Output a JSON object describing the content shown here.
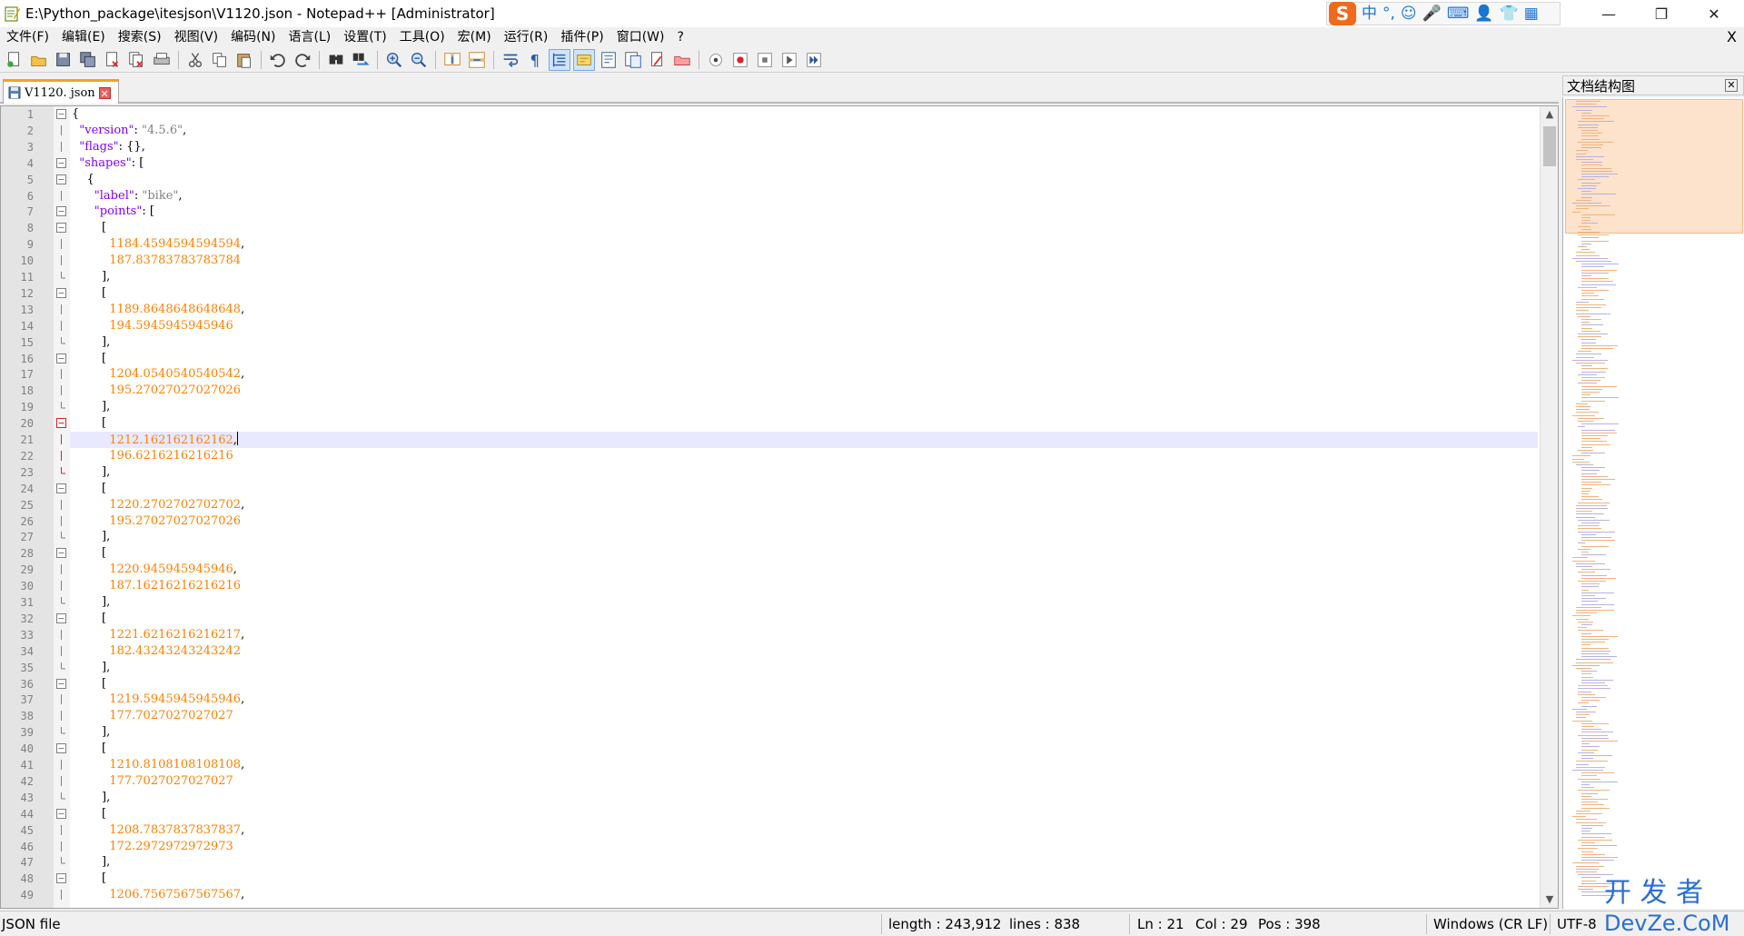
{
  "window": {
    "title": "E:\\Python_package\\itesjson\\V1120.json - Notepad++ [Administrator]",
    "minimize": "—",
    "restore": "❐",
    "close": "✕"
  },
  "menu": {
    "items": [
      "文件(F)",
      "编辑(E)",
      "搜索(S)",
      "视图(V)",
      "编码(N)",
      "语言(L)",
      "设置(T)",
      "工具(O)",
      "宏(M)",
      "运行(R)",
      "插件(P)",
      "窗口(W)",
      "?"
    ],
    "close": "X"
  },
  "ime": {
    "logo": "S",
    "glyphs": [
      "中",
      "°,",
      "☺",
      "🎤",
      "⌨",
      "👤",
      "👕",
      "▦"
    ]
  },
  "toolbar": {
    "icons": [
      "new-file-icon",
      "open-file-icon",
      "save-icon",
      "save-all-icon",
      "close-icon",
      "close-all-icon",
      "print-icon",
      "cut-icon",
      "copy-icon",
      "paste-icon",
      "undo-icon",
      "redo-icon",
      "find-icon",
      "replace-icon",
      "zoom-in-icon",
      "zoom-out-icon",
      "sync-vertical-icon",
      "sync-horizontal-icon",
      "word-wrap-icon",
      "show-all-chars-icon",
      "indent-guide-icon",
      "user-lang-icon",
      "doc-map-icon",
      "function-list-icon",
      "folder-workspace-icon",
      "monitor-icon",
      "record-macro-icon",
      "stop-record-icon",
      "play-macro-icon",
      "run-macro-multiple-icon",
      "save-macro-icon"
    ]
  },
  "tab": {
    "label": "V1120. json",
    "close": "✕"
  },
  "editor": {
    "current_line": 21,
    "lines": [
      {
        "n": 1,
        "text": "{",
        "fold": "box"
      },
      {
        "n": 2,
        "text": "  \"version\": \"4.5.6\",",
        "fold": "line"
      },
      {
        "n": 3,
        "text": "  \"flags\": {},",
        "fold": "line"
      },
      {
        "n": 4,
        "text": "  \"shapes\": [",
        "fold": "box"
      },
      {
        "n": 5,
        "text": "    {",
        "fold": "box"
      },
      {
        "n": 6,
        "text": "      \"label\": \"bike\",",
        "fold": "line"
      },
      {
        "n": 7,
        "text": "      \"points\": [",
        "fold": "box"
      },
      {
        "n": 8,
        "text": "        [",
        "fold": "box"
      },
      {
        "n": 9,
        "text": "          1184.4594594594594,",
        "fold": "line"
      },
      {
        "n": 10,
        "text": "          187.83783783783784",
        "fold": "line"
      },
      {
        "n": 11,
        "text": "        ],",
        "fold": "end"
      },
      {
        "n": 12,
        "text": "        [",
        "fold": "box"
      },
      {
        "n": 13,
        "text": "          1189.8648648648648,",
        "fold": "line"
      },
      {
        "n": 14,
        "text": "          194.5945945945946",
        "fold": "line"
      },
      {
        "n": 15,
        "text": "        ],",
        "fold": "end"
      },
      {
        "n": 16,
        "text": "        [",
        "fold": "box"
      },
      {
        "n": 17,
        "text": "          1204.0540540540542,",
        "fold": "line"
      },
      {
        "n": 18,
        "text": "          195.27027027027026",
        "fold": "line"
      },
      {
        "n": 19,
        "text": "        ],",
        "fold": "end"
      },
      {
        "n": 20,
        "text": "        [",
        "fold": "boxred"
      },
      {
        "n": 21,
        "text": "          1212.162162162162,",
        "fold": "linered"
      },
      {
        "n": 22,
        "text": "          196.6216216216216",
        "fold": "linered"
      },
      {
        "n": 23,
        "text": "        ],",
        "fold": "endred"
      },
      {
        "n": 24,
        "text": "        [",
        "fold": "box"
      },
      {
        "n": 25,
        "text": "          1220.2702702702702,",
        "fold": "line"
      },
      {
        "n": 26,
        "text": "          195.27027027027026",
        "fold": "line"
      },
      {
        "n": 27,
        "text": "        ],",
        "fold": "end"
      },
      {
        "n": 28,
        "text": "        [",
        "fold": "box"
      },
      {
        "n": 29,
        "text": "          1220.945945945946,",
        "fold": "line"
      },
      {
        "n": 30,
        "text": "          187.16216216216216",
        "fold": "line"
      },
      {
        "n": 31,
        "text": "        ],",
        "fold": "end"
      },
      {
        "n": 32,
        "text": "        [",
        "fold": "box"
      },
      {
        "n": 33,
        "text": "          1221.6216216216217,",
        "fold": "line"
      },
      {
        "n": 34,
        "text": "          182.43243243243242",
        "fold": "line"
      },
      {
        "n": 35,
        "text": "        ],",
        "fold": "end"
      },
      {
        "n": 36,
        "text": "        [",
        "fold": "box"
      },
      {
        "n": 37,
        "text": "          1219.5945945945946,",
        "fold": "line"
      },
      {
        "n": 38,
        "text": "          177.7027027027027",
        "fold": "line"
      },
      {
        "n": 39,
        "text": "        ],",
        "fold": "end"
      },
      {
        "n": 40,
        "text": "        [",
        "fold": "box"
      },
      {
        "n": 41,
        "text": "          1210.8108108108108,",
        "fold": "line"
      },
      {
        "n": 42,
        "text": "          177.7027027027027",
        "fold": "line"
      },
      {
        "n": 43,
        "text": "        ],",
        "fold": "end"
      },
      {
        "n": 44,
        "text": "        [",
        "fold": "box"
      },
      {
        "n": 45,
        "text": "          1208.7837837837837,",
        "fold": "line"
      },
      {
        "n": 46,
        "text": "          172.2972972972973",
        "fold": "line"
      },
      {
        "n": 47,
        "text": "        ],",
        "fold": "end"
      },
      {
        "n": 48,
        "text": "        [",
        "fold": "box"
      },
      {
        "n": 49,
        "text": "          1206.7567567567567,",
        "fold": "line"
      }
    ]
  },
  "docmap": {
    "title": "文档结构图",
    "close": "✕"
  },
  "status": {
    "file_type": "JSON file",
    "length": "length : 243,912",
    "lines": "lines : 838",
    "ln": "Ln : 21",
    "col": "Col : 29",
    "pos": "Pos : 398",
    "eol": "Windows (CR LF)",
    "encoding": "UTF-8"
  },
  "watermark": {
    "line1": "开 发 者",
    "line2": "DevZe.CoM"
  },
  "colors": {
    "keyword": "#8000ff",
    "number": "#ff8000",
    "current_line_bg": "#e8e8ff",
    "tab_accent": "#f7a11b"
  }
}
